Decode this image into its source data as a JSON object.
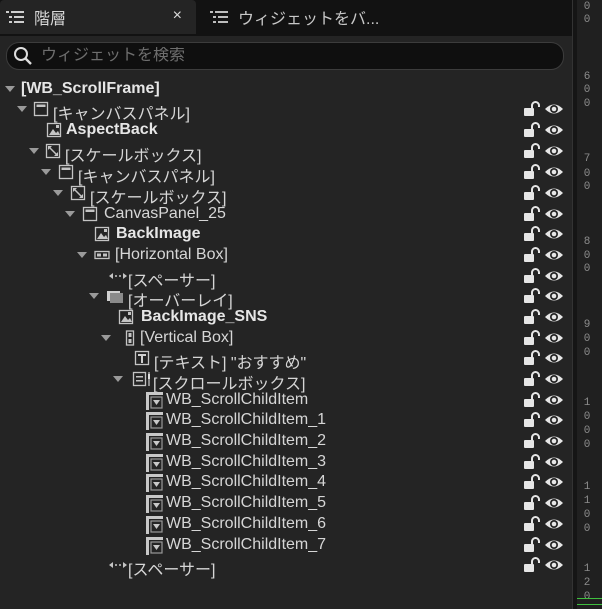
{
  "tabs": [
    {
      "label": "階層",
      "active": true
    },
    {
      "label": "ウィジェットをバ...",
      "active": false
    }
  ],
  "close_glyph": "×",
  "search": {
    "placeholder": "ウィジェットを検索",
    "value": ""
  },
  "tree": [
    {
      "label": "[WB_ScrollFrame]",
      "icon": "none",
      "expanded": true,
      "bold": true,
      "controls": false
    },
    {
      "label": "[キャンバスパネル]",
      "icon": "canvas-panel-icon",
      "expanded": true,
      "bold": false,
      "controls": true
    },
    {
      "label": "AspectBack",
      "icon": "image-icon",
      "expanded": null,
      "bold": true,
      "controls": true
    },
    {
      "label": "[スケールボックス]",
      "icon": "scale-box-icon",
      "expanded": true,
      "bold": false,
      "controls": true
    },
    {
      "label": "[キャンバスパネル]",
      "icon": "canvas-panel-icon",
      "expanded": true,
      "bold": false,
      "controls": true
    },
    {
      "label": "[スケールボックス]",
      "icon": "scale-box-icon",
      "expanded": true,
      "bold": false,
      "controls": true
    },
    {
      "label": "CanvasPanel_25",
      "icon": "canvas-panel-icon",
      "expanded": true,
      "bold": false,
      "controls": true
    },
    {
      "label": "BackImage",
      "icon": "image-icon",
      "expanded": null,
      "bold": true,
      "controls": true
    },
    {
      "label": "[Horizontal Box]",
      "icon": "horizontal-box-icon",
      "expanded": true,
      "bold": false,
      "controls": true
    },
    {
      "label": "[スペーサー]",
      "icon": "spacer-icon",
      "expanded": null,
      "bold": false,
      "controls": true
    },
    {
      "label": "[オーバーレイ]",
      "icon": "overlay-icon",
      "expanded": true,
      "bold": false,
      "controls": true
    },
    {
      "label": "BackImage_SNS",
      "icon": "image-icon",
      "expanded": null,
      "bold": true,
      "controls": true
    },
    {
      "label": "[Vertical Box]",
      "icon": "vertical-box-icon",
      "expanded": true,
      "bold": false,
      "controls": true
    },
    {
      "label": "[テキスト] \"おすすめ\"",
      "icon": "text-icon",
      "expanded": null,
      "bold": false,
      "controls": true
    },
    {
      "label": "[スクロールボックス]",
      "icon": "scroll-box-icon",
      "expanded": true,
      "bold": false,
      "controls": true
    },
    {
      "label": "WB_ScrollChildItem",
      "icon": "user-widget-icon",
      "expanded": null,
      "bold": false,
      "controls": true
    },
    {
      "label": "WB_ScrollChildItem_1",
      "icon": "user-widget-icon",
      "expanded": null,
      "bold": false,
      "controls": true
    },
    {
      "label": "WB_ScrollChildItem_2",
      "icon": "user-widget-icon",
      "expanded": null,
      "bold": false,
      "controls": true
    },
    {
      "label": "WB_ScrollChildItem_3",
      "icon": "user-widget-icon",
      "expanded": null,
      "bold": false,
      "controls": true
    },
    {
      "label": "WB_ScrollChildItem_4",
      "icon": "user-widget-icon",
      "expanded": null,
      "bold": false,
      "controls": true
    },
    {
      "label": "WB_ScrollChildItem_5",
      "icon": "user-widget-icon",
      "expanded": null,
      "bold": false,
      "controls": true
    },
    {
      "label": "WB_ScrollChildItem_6",
      "icon": "user-widget-icon",
      "expanded": null,
      "bold": false,
      "controls": true
    },
    {
      "label": "WB_ScrollChildItem_7",
      "icon": "user-widget-icon",
      "expanded": null,
      "bold": false,
      "controls": true
    },
    {
      "label": "[スペーサー]",
      "icon": "spacer-icon",
      "expanded": null,
      "bold": false,
      "controls": true
    }
  ],
  "ruler_labels": [
    "0",
    "0",
    "6",
    "0",
    "0",
    "7",
    "0",
    "0",
    "8",
    "0",
    "0",
    "9",
    "0",
    "0",
    "1",
    "0",
    "0",
    "0",
    "1",
    "1",
    "0",
    "0",
    "1",
    "2",
    "0"
  ],
  "colors": {
    "panel": "#242424",
    "tab_bar": "#121212",
    "ruler_mark": "#3fbf3f"
  }
}
